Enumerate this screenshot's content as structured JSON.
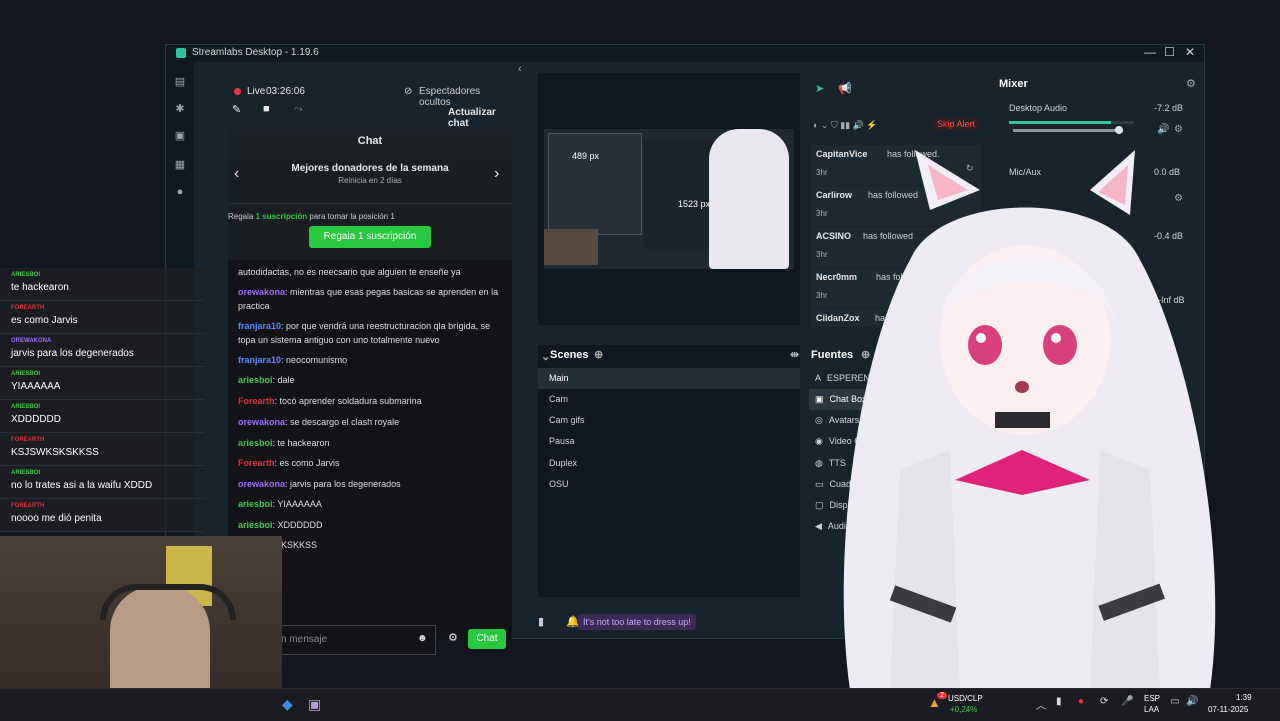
{
  "window": {
    "title": "Streamlabs Desktop - 1.19.6",
    "controls": [
      "—",
      "☐",
      "✕"
    ]
  },
  "stream": {
    "live_label": "Live",
    "live_time": "03:26:06",
    "viewers_hidden": "Espectadores ocultos",
    "update_chat": "Actualizar chat"
  },
  "chat": {
    "title": "Chat",
    "donors_title": "Mejores donadores de la semana",
    "donors_sub": "Reinicia en 2 días",
    "gift_text_a": "Regala",
    "gift_text_b": "1 suscripción",
    "gift_text_c": "para tomar la posición 1",
    "gift_button": "Regala 1 suscripción",
    "messages": [
      {
        "user": "",
        "color": "#dddddd",
        "text": "autodidactas, no es neecsario que alguien te enseñe ya"
      },
      {
        "user": "orewakona",
        "color": "#9b6bff",
        "text": "mientras que esas pegas basicas se aprenden en la practica"
      },
      {
        "user": "franjara10",
        "color": "#4f8cff",
        "text": "por que vendrá una reestructuracion qla brígida, se topa un sistema antiguo con uno totalmente nuevo"
      },
      {
        "user": "franjara10",
        "color": "#4f8cff",
        "text": "neocomunismo"
      },
      {
        "user": "ariesboi",
        "color": "#3fc84a",
        "text": "dale"
      },
      {
        "user": "Forearth",
        "color": "#e0303a",
        "text": "tocó aprender soldadura submarina"
      },
      {
        "user": "orewakona",
        "color": "#9b6bff",
        "text": "se descargo el clash royale"
      },
      {
        "user": "ariesboi",
        "color": "#3fc84a",
        "text": "te hackearon"
      },
      {
        "user": "Forearth",
        "color": "#e0303a",
        "text": "es como Jarvis"
      },
      {
        "user": "orewakona",
        "color": "#9b6bff",
        "text": "jarvis para los degenerados"
      },
      {
        "user": "ariesboi",
        "color": "#3fc84a",
        "text": "YIAAAAAA"
      },
      {
        "user": "ariesboi",
        "color": "#3fc84a",
        "text": "XDDDDDD"
      },
      {
        "user": "",
        "color": "#dddddd",
        "text": "KSJSWKSKSKKSS"
      }
    ],
    "moderators_label": "dores",
    "input_placeholder": "n mensaje",
    "send_button": "Chat"
  },
  "preview": {
    "label_w": "489 px",
    "label_h": "1523 px"
  },
  "scenes": {
    "title": "Scenes",
    "items": [
      "Main",
      "Cam",
      "Cam gifs",
      "Pausa",
      "Duplex",
      "OSU"
    ]
  },
  "sources": {
    "title": "Fuentes",
    "items": [
      "ESPEREN",
      "Chat Box",
      "Avatars",
      "Video Capture Devi",
      "TTS",
      "Cuadro de aler",
      "Display Capt",
      "Audio O"
    ]
  },
  "alerts": {
    "skip": "Skip Alert",
    "items": [
      {
        "name": "CapitanVice",
        "text": "has followed.",
        "time": "3hr"
      },
      {
        "name": "Carlirow",
        "text": "has followed",
        "time": "3hr"
      },
      {
        "name": "ACSINO",
        "text": "has followed",
        "time": "3hr"
      },
      {
        "name": "Necr0mm",
        "text": "has follo",
        "time": "3hr"
      },
      {
        "name": "CiidanZox",
        "text": "has fo",
        "time": ""
      }
    ]
  },
  "mixer": {
    "title": "Mixer",
    "channels": [
      {
        "name": "Desktop Audio",
        "db": "-7.2 dB",
        "level": 0.82
      },
      {
        "name": "Mic/Aux",
        "db": "0.0 dB",
        "level": 1.0
      },
      {
        "name": "",
        "db": "-0.4 dB",
        "level": 0.7
      },
      {
        "name": "",
        "db": "-Inf dB",
        "level": 0.0
      }
    ]
  },
  "bottombar": {
    "tip": "It's not too late to dress up!"
  },
  "overlay_chat": [
    {
      "user": "ARIESBOI",
      "color": "#3fc84a",
      "text": "te hackearon"
    },
    {
      "user": "FOREARTH",
      "color": "#e0303a",
      "text": "es como Jarvis"
    },
    {
      "user": "OREWAKONA",
      "color": "#9b6bff",
      "text": "jarvis para los degenerados"
    },
    {
      "user": "ARIESBOI",
      "color": "#3fc84a",
      "text": "YIAAAAAA"
    },
    {
      "user": "ARIESBOI",
      "color": "#3fc84a",
      "text": "XDDDDDD"
    },
    {
      "user": "FOREARTH",
      "color": "#e0303a",
      "text": "KSJSWKSKSKKSS"
    },
    {
      "user": "ARIESBOI",
      "color": "#3fc84a",
      "text": "no lo trates asi a la waifu XDDD"
    },
    {
      "user": "FOREARTH",
      "color": "#e0303a",
      "text": "noooo me dió penita"
    }
  ],
  "taskbar": {
    "ticker_name": "USD/CLP",
    "ticker_change": "+0,24%",
    "lang_top": "ESP",
    "lang_bottom": "LAA",
    "time": "1:39",
    "date": "07-11-2025",
    "badge": "2"
  },
  "colors": {
    "accent_green": "#28c840",
    "alert_red": "#e33",
    "app_bg": "#17242d"
  }
}
